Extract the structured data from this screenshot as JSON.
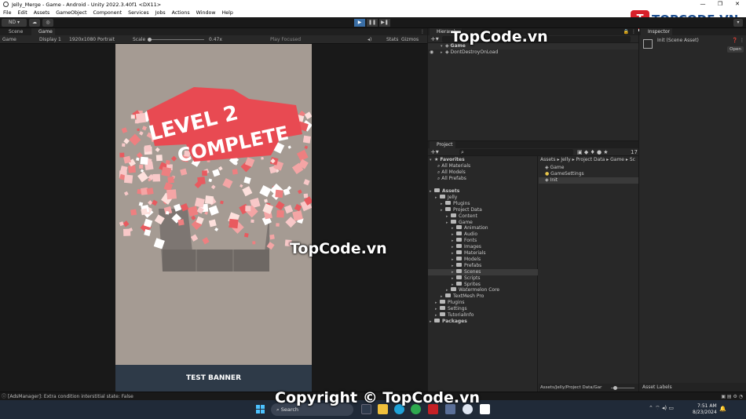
{
  "window": {
    "title": "Jelly_Merge - Game - Android - Unity 2022.3.40f1 <DX11>",
    "controls": [
      "—",
      "❐",
      "✕"
    ]
  },
  "menu": [
    "File",
    "Edit",
    "Assets",
    "GameObject",
    "Component",
    "Services",
    "Jobs",
    "Actions",
    "Window",
    "Help"
  ],
  "toolbar": {
    "account": "ND"
  },
  "game_tabs": {
    "scene": "Scene",
    "game": "Game"
  },
  "game_bar": {
    "mode": "Game",
    "display": "Display 1",
    "resolution": "1920x1080 Portrait",
    "scale_label": "Scale",
    "scale_value": "0.47x",
    "play_focused": "Play Focused",
    "stats": "Stats",
    "gizmos": "Gizmos"
  },
  "game_view": {
    "title_line1": "LEVEL 2",
    "title_line2": "COMPLETE",
    "banner": "TEST BANNER"
  },
  "hierarchy": {
    "tab": "Hierarchy",
    "items": [
      "Game",
      "DontDestroyOnLoad"
    ]
  },
  "inspector": {
    "tab": "Inspector",
    "asset_name": "Init (Scene Asset)",
    "open_button": "Open",
    "bottom_label": "Asset Labels"
  },
  "project": {
    "tab": "Project",
    "count": "17",
    "breadcrumb": [
      "Assets",
      "Jelly",
      "Project Data",
      "Game",
      "Sc"
    ],
    "favorites": {
      "label": "Favorites",
      "items": [
        "All Materials",
        "All Models",
        "All Prefabs"
      ]
    },
    "tree": [
      {
        "label": "Assets",
        "depth": 0,
        "bold": true
      },
      {
        "label": "Jelly",
        "depth": 1
      },
      {
        "label": "Plugins",
        "depth": 2
      },
      {
        "label": "Project Data",
        "depth": 2
      },
      {
        "label": "Content",
        "depth": 3
      },
      {
        "label": "Game",
        "depth": 3
      },
      {
        "label": "Animation",
        "depth": 4
      },
      {
        "label": "Audio",
        "depth": 4
      },
      {
        "label": "Fonts",
        "depth": 4
      },
      {
        "label": "Images",
        "depth": 4
      },
      {
        "label": "Materials",
        "depth": 4
      },
      {
        "label": "Models",
        "depth": 4
      },
      {
        "label": "Prefabs",
        "depth": 4
      },
      {
        "label": "Scenes",
        "depth": 4,
        "selected": true
      },
      {
        "label": "Scripts",
        "depth": 4
      },
      {
        "label": "Sprites",
        "depth": 4
      },
      {
        "label": "Watermelon Core",
        "depth": 3
      },
      {
        "label": "TextMesh Pro",
        "depth": 2
      },
      {
        "label": "Plugins",
        "depth": 1
      },
      {
        "label": "Settings",
        "depth": 1
      },
      {
        "label": "TutorialInfo",
        "depth": 1
      },
      {
        "label": "Packages",
        "depth": 0,
        "bold": true
      }
    ],
    "files": [
      "Game",
      "GameSettings",
      "Init"
    ],
    "footer_path": "Assets/Jelly/Project Data/Gar"
  },
  "status": {
    "message": "[AdsManager]: Extra condition interstitial state: False"
  },
  "taskbar": {
    "search": "Search",
    "time": "7:51 AM",
    "date": "8/23/2024"
  },
  "watermarks": {
    "logo": "TOPCODE.VN",
    "center": "TopCode.vn",
    "top": "TopCode.vn",
    "bottom": "Copyright © TopCode.vn"
  },
  "colors": {
    "editor_bg": "#191919",
    "panel_bg": "#282828",
    "game_bg": "#a59b93",
    "banner_bg": "#2e3a48",
    "accent_red": "#e84a52",
    "selection": "#2c5d87"
  }
}
